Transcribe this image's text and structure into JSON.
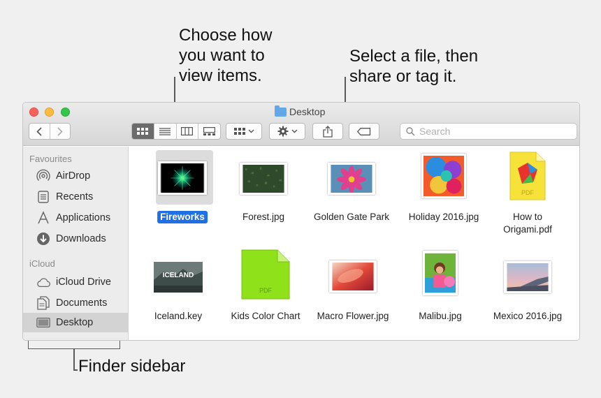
{
  "callouts": {
    "view": "Choose how\nyou want to\nview items.",
    "share": "Select a file, then\nshare or tag it.",
    "sidebar": "Finder sidebar"
  },
  "window": {
    "title": "Desktop",
    "search_placeholder": "Search"
  },
  "sidebar": {
    "favourites_heading": "Favourites",
    "favourites": [
      {
        "label": "AirDrop",
        "icon": "airdrop-icon"
      },
      {
        "label": "Recents",
        "icon": "recents-icon"
      },
      {
        "label": "Applications",
        "icon": "applications-icon"
      },
      {
        "label": "Downloads",
        "icon": "downloads-icon"
      }
    ],
    "icloud_heading": "iCloud",
    "icloud": [
      {
        "label": "iCloud Drive",
        "icon": "cloud-icon"
      },
      {
        "label": "Documents",
        "icon": "documents-icon"
      },
      {
        "label": "Desktop",
        "icon": "desktop-icon"
      }
    ]
  },
  "files": [
    {
      "name": "Fireworks"
    },
    {
      "name": "Forest.jpg"
    },
    {
      "name": "Golden Gate Park"
    },
    {
      "name": "Holiday 2016.jpg"
    },
    {
      "name": "How to\nOrigami.pdf",
      "badge": "PDF"
    },
    {
      "name": "Iceland.key",
      "badge": "ICELAND"
    },
    {
      "name": "Kids Color Chart",
      "badge": "PDF"
    },
    {
      "name": "Macro Flower.jpg"
    },
    {
      "name": "Malibu.jpg"
    },
    {
      "name": "Mexico 2016.jpg"
    }
  ],
  "colors": {
    "selection": "#1f6fe5",
    "sidebar_bg": "#ececec",
    "kids_chart": "#8fe21a"
  }
}
